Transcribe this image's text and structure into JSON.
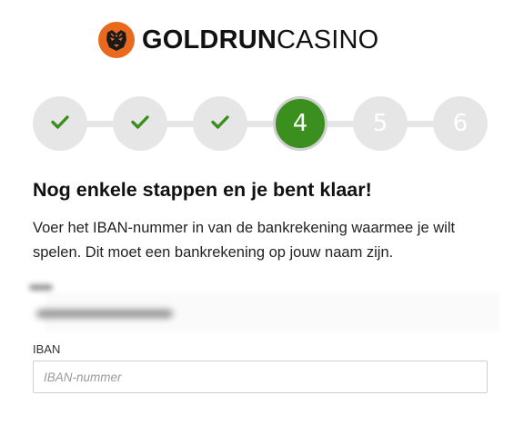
{
  "brand": {
    "name_bold": "GOLDRUN",
    "name_light": "CASINO",
    "logo_icon": "tiger-icon",
    "accent": "#e9691e"
  },
  "stepper": {
    "steps": [
      {
        "label": "",
        "state": "completed",
        "icon": "check-icon"
      },
      {
        "label": "",
        "state": "completed",
        "icon": "check-icon"
      },
      {
        "label": "",
        "state": "completed",
        "icon": "check-icon"
      },
      {
        "label": "4",
        "state": "active"
      },
      {
        "label": "5",
        "state": "upcoming"
      },
      {
        "label": "6",
        "state": "upcoming"
      }
    ],
    "active_color": "#3a8f1f",
    "inactive_color": "#e6e6e6"
  },
  "main": {
    "title": "Nog enkele stappen en je bent klaar!",
    "description": "Voer het IBAN-nummer in van de bankrekening waarmee je wilt spelen. Dit moet een bankrekening op jouw naam zijn."
  },
  "form": {
    "iban_label": "IBAN",
    "iban_placeholder": "IBAN-nummer",
    "iban_value": ""
  }
}
